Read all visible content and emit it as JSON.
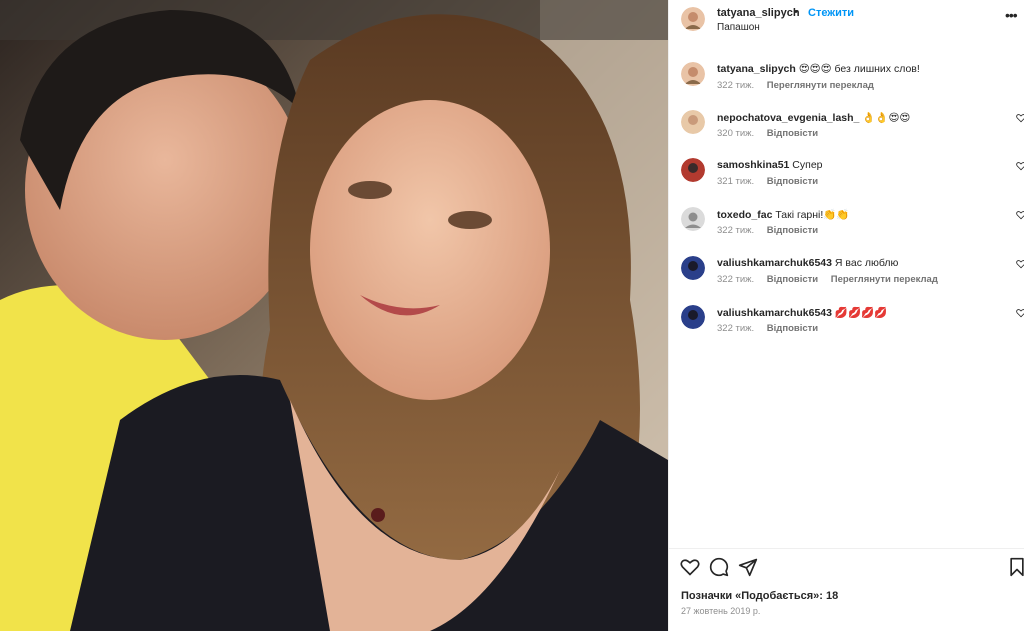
{
  "post": {
    "username": "tatyana_slipych",
    "separator": "•",
    "follow_label": "Стежити",
    "location": "Папашон",
    "more_icon": "more-horizontal-icon"
  },
  "caption": {
    "username": "tatyana_slipych",
    "text": "😍😍😍 без лишних слов!",
    "time": "322 тиж.",
    "translate_label": "Переглянути переклад"
  },
  "comments": [
    {
      "username": "nepochatova_evgenia_lash_",
      "text": "👌👌😍😍",
      "time": "320 тиж.",
      "reply_label": "Відповісти",
      "avatar_color": "#e8c9a8"
    },
    {
      "username": "samoshkina51",
      "text": "Супер",
      "time": "321 тиж.",
      "reply_label": "Відповісти",
      "avatar_color": "#b23a2f"
    },
    {
      "username": "toxedo_fac",
      "text": "Такі гарні!👏👏",
      "time": "322 тиж.",
      "reply_label": "Відповісти",
      "avatar_color": "#dbdbdb"
    },
    {
      "username": "valiushkamarchuk6543",
      "text": "Я вас люблю",
      "time": "322 тиж.",
      "reply_label": "Відповісти",
      "translate_label": "Переглянути переклад",
      "avatar_color": "#2a3f8a"
    },
    {
      "username": "valiushkamarchuk6543",
      "text": "💋💋💋💋",
      "time": "322 тиж.",
      "reply_label": "Відповісти",
      "avatar_color": "#2a3f8a"
    }
  ],
  "footer": {
    "likes_text": "Позначки «Подобається»: 18",
    "date": "27 жовтень 2019 р."
  },
  "icons": [
    "heart-icon",
    "comment-icon",
    "share-icon",
    "bookmark-icon"
  ],
  "colors": {
    "accent": "#0095f6",
    "text": "#262626",
    "muted": "#8e8e8e"
  }
}
